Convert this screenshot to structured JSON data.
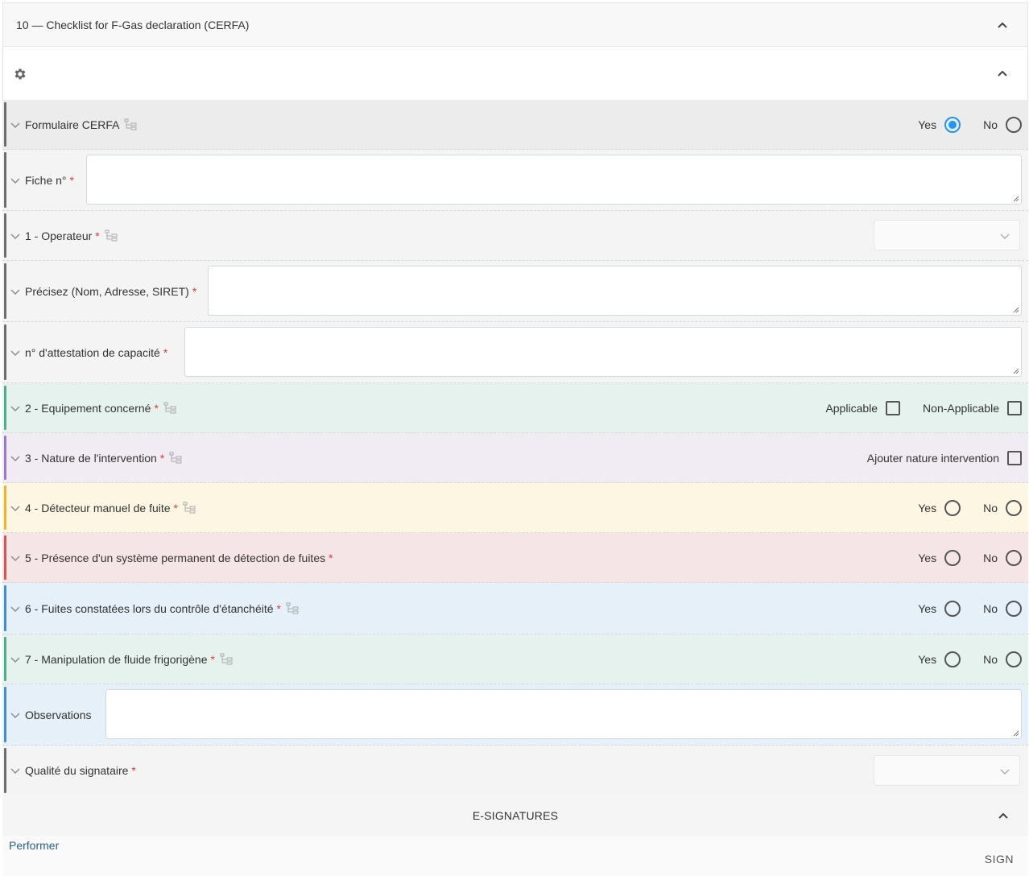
{
  "section": {
    "title": "10 — Checklist for F-Gas declaration (CERFA)"
  },
  "toolbar": {
    "icon": "gear-icon"
  },
  "fields": {
    "formulaire": {
      "label": "Formulaire CERFA",
      "required": false,
      "yes_label": "Yes",
      "no_label": "No",
      "selected": "Yes",
      "accent": "#6d6d6d"
    },
    "fiche": {
      "label": "Fiche n°",
      "required_mark": "*",
      "value": "",
      "accent": "#6d6d6d"
    },
    "operateur": {
      "label": "1 - Operateur",
      "required_mark": "*",
      "selected_value": "",
      "accent": "#6d6d6d"
    },
    "precisez": {
      "label": "Précisez (Nom, Adresse, SIRET)",
      "required_mark": "*",
      "value": "",
      "accent": "#6d6d6d"
    },
    "attestation": {
      "label": "n° d'attestation de capacité",
      "required_mark": "*",
      "value": "",
      "accent": "#6d6d6d"
    },
    "equipement": {
      "label": "2 - Equipement concerné",
      "required_mark": "*",
      "applicable_label": "Applicable",
      "non_applicable_label": "Non-Applicable",
      "accent": "#4caf8f"
    },
    "nature": {
      "label": "3 - Nature de l'intervention",
      "required_mark": "*",
      "add_label": "Ajouter nature intervention",
      "accent": "#a179c9"
    },
    "detecteur": {
      "label": "4 - Détecteur manuel de fuite",
      "required_mark": "*",
      "yes_label": "Yes",
      "no_label": "No",
      "selected": "",
      "accent": "#f0b429"
    },
    "presence": {
      "label": "5 - Présence d'un système permanent de détection de fuites",
      "required_mark": "*",
      "yes_label": "Yes",
      "no_label": "No",
      "selected": "",
      "accent": "#e05050"
    },
    "fuites": {
      "label": "6 - Fuites constatées lors du contrôle d'étanchéité",
      "required_mark": "*",
      "yes_label": "Yes",
      "no_label": "No",
      "selected": "",
      "accent": "#3f8fd2"
    },
    "manipulation": {
      "label": "7 - Manipulation de fluide frigorigène",
      "required_mark": "*",
      "yes_label": "Yes",
      "no_label": "No",
      "selected": "",
      "accent": "#4caf8f"
    },
    "observations": {
      "label": "Observations",
      "value": "",
      "accent": "#3f8fd2"
    },
    "qualite": {
      "label": "Qualité du signataire",
      "required_mark": "*",
      "selected_value": "",
      "accent": "#6d6d6d"
    }
  },
  "esignatures": {
    "title": "E-SIGNATURES",
    "performer_label": "Performer",
    "sign_label": "SIGN"
  },
  "colors": {
    "grey_row": "#ececec",
    "light_row": "#f4f4f4",
    "green_row": "#e6f2ee",
    "purple_row": "#f1ebf4",
    "yellow_row": "#fdf6e3",
    "red_row": "#f6e5e6",
    "blue_row": "#e6f0f8",
    "required": "#e53935",
    "radio_selected": "#2196f3"
  }
}
